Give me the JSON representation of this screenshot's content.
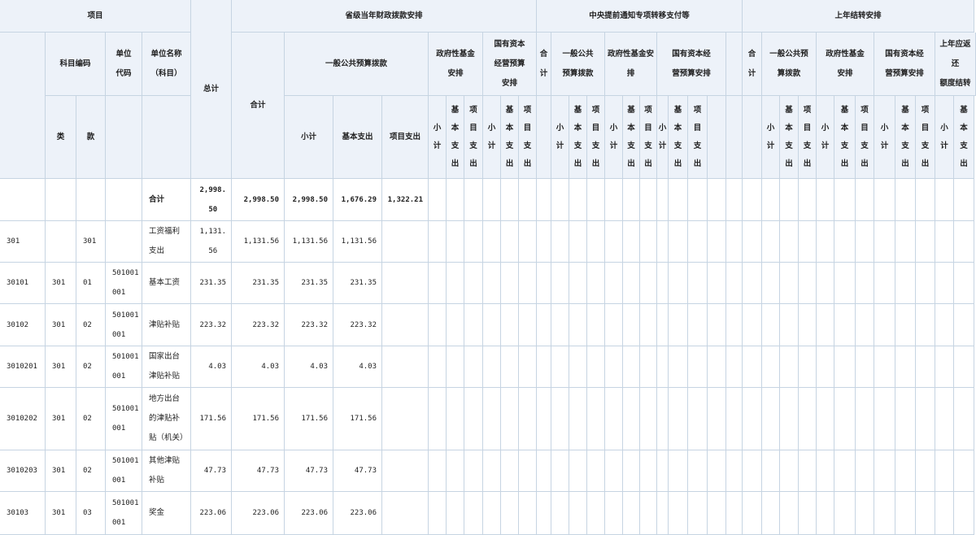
{
  "header": {
    "xiangmu": "项目",
    "zongji": "总计",
    "g1": "省级当年财政拨款安排",
    "g2": "中央提前通知专项转移支付等",
    "g3": "上年结转安排",
    "kemu_code": "科目编码",
    "unit_code": "单位\n代码",
    "unit_name": "单位名称\n（科目）",
    "g1_heji": "合计",
    "g1_ybgg": "一般公共预算拨款",
    "g1_zfxjj": "政府性基金\n安排",
    "g1_gyzb": "国有资本\n经营预算\n安排",
    "g2_heji": "合\n计",
    "g2_ybgg": "一般公共\n预算拨款",
    "g2_zfxjj": "政府性基金安\n排",
    "g2_gyzb": "国有资本经\n营预算安排",
    "g3_heji": "合\n计",
    "g3_ybgg": "一般公共预\n算拨款",
    "g3_zfxjj": "政府性基金\n安排",
    "g3_gyzb": "国有资本经\n营预算安排",
    "g3_fhjz": "上年应返还\n额度结转",
    "lei": "类",
    "kuan": "款",
    "xiaoji": "小计",
    "jiben": "基本支出",
    "xiangmu_zc": "项目支出",
    "v_xiaoji": "小\n计",
    "v_jiben": "基\n本\n支\n出",
    "v_xiangmu": "项\n目\n支\n出"
  },
  "rows": [
    {
      "code": "",
      "lei": "",
      "kuan": "",
      "unit": "",
      "name": "合计",
      "total": "2,998.\n50",
      "heji": "2,998.50",
      "xiaoji": "2,998.50",
      "jiben": "1,676.29",
      "xiangmu": "1,322.21"
    },
    {
      "code": "301",
      "lei": "",
      "kuan": "301",
      "unit": "",
      "name": "工资福利\n支出",
      "total": "1,131.\n56",
      "heji": "1,131.56",
      "xiaoji": "1,131.56",
      "jiben": "1,131.56",
      "xiangmu": ""
    },
    {
      "code": "30101",
      "lei": "301",
      "kuan": "01",
      "unit": "501001\n001",
      "name": "基本工资",
      "total": "231.35",
      "heji": "231.35",
      "xiaoji": "231.35",
      "jiben": "231.35",
      "xiangmu": ""
    },
    {
      "code": "30102",
      "lei": "301",
      "kuan": "02",
      "unit": "501001\n001",
      "name": "津贴补贴",
      "total": "223.32",
      "heji": "223.32",
      "xiaoji": "223.32",
      "jiben": "223.32",
      "xiangmu": ""
    },
    {
      "code": "3010201",
      "lei": "301",
      "kuan": "02",
      "unit": "501001\n001",
      "name": "国家出台\n津贴补贴",
      "total": "4.03",
      "heji": "4.03",
      "xiaoji": "4.03",
      "jiben": "4.03",
      "xiangmu": ""
    },
    {
      "code": "3010202",
      "lei": "301",
      "kuan": "02",
      "unit": "501001\n001",
      "name": "地方出台\n的津贴补\n贴（机关）",
      "total": "171.56",
      "heji": "171.56",
      "xiaoji": "171.56",
      "jiben": "171.56",
      "xiangmu": ""
    },
    {
      "code": "3010203",
      "lei": "301",
      "kuan": "02",
      "unit": "501001\n001",
      "name": "其他津贴\n补贴",
      "total": "47.73",
      "heji": "47.73",
      "xiaoji": "47.73",
      "jiben": "47.73",
      "xiangmu": ""
    },
    {
      "code": "30103",
      "lei": "301",
      "kuan": "03",
      "unit": "501001\n001",
      "name": "奖金",
      "total": "223.06",
      "heji": "223.06",
      "xiaoji": "223.06",
      "jiben": "223.06",
      "xiangmu": ""
    }
  ]
}
